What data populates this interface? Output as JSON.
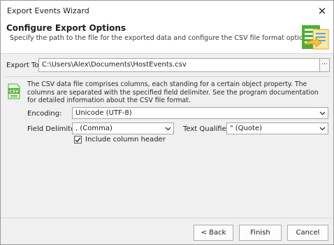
{
  "window": {
    "title": "Export Events Wizard",
    "close_glyph": "✕"
  },
  "header": {
    "title": "Configure Export Options",
    "subtitle": "Specify the path to the file for the exported data and configure the CSV file format options.",
    "icon": "export-wizard-icon"
  },
  "export": {
    "label": "Export To:",
    "path": "C:\\Users\\Alex\\Documents\\HostEvents.csv",
    "browse_label": "···"
  },
  "csv": {
    "icon_text": "CSV",
    "description": "The CSV data file comprises columns, each standing for a certain object property. The columns are separated with the specified field delimiter. See the program documentation for detailed information about the CSV file format."
  },
  "encoding": {
    "label": "Encoding:",
    "value": "Unicode (UTF-8)"
  },
  "delimiter": {
    "label": "Field Delimiter:",
    "value": ", (Comma)"
  },
  "qualifier": {
    "label": "Text Qualifier:",
    "value": "\" (Quote)"
  },
  "include_header": {
    "label": "Include column header",
    "checked": true
  },
  "buttons": {
    "back": "< Back",
    "finish": "Finish",
    "cancel": "Cancel"
  },
  "colors": {
    "accent_green": "#4caf35",
    "icon_yellow": "#f2c33a",
    "icon_blue": "#5ba3dc"
  }
}
